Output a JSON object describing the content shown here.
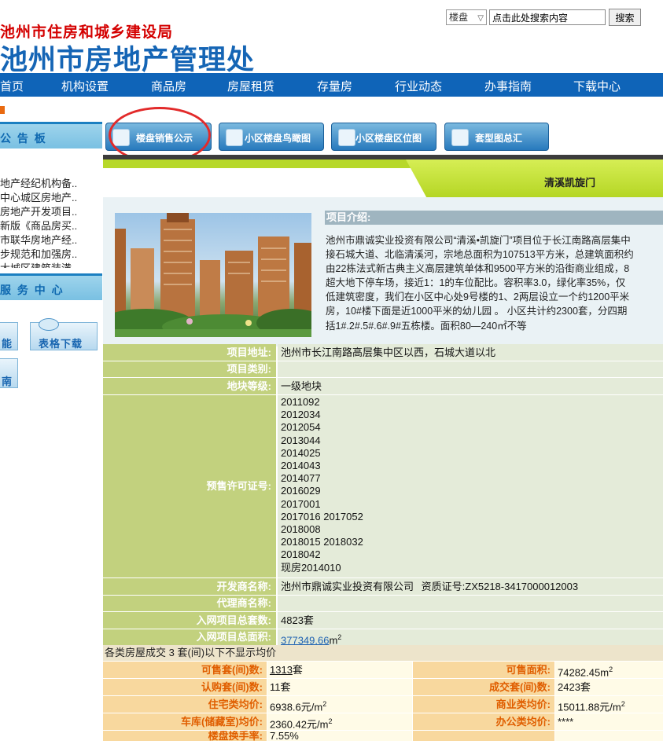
{
  "header": {
    "sub_title": "池州市住房和城乡建设局",
    "main_title": "池州市房地产管理处",
    "search": {
      "select_value": "楼盘",
      "input_value": "点击此处搜索内容",
      "button_label": "搜索"
    }
  },
  "nav": [
    "首页",
    "机构设置",
    "商品房",
    "房屋租赁",
    "存量房",
    "行业动态",
    "办事指南",
    "下载中心"
  ],
  "sidebar": {
    "notice_title": "公 告 板",
    "notices": [
      "地产经纪机构备..",
      "中心城区房地产..",
      "房地产开发项目..",
      "新版《商品房买..",
      "市联华房地产经..",
      "步规范和加强房..",
      "大城区建筑装潢.."
    ],
    "service_title": "服 务 中 心",
    "btn_func": "能",
    "btn_download": "表格下载",
    "btn_guide": "南"
  },
  "tabs": [
    "楼盘销售公示",
    "小区楼盘鸟瞰图",
    "小区楼盘区位图",
    "套型图总汇"
  ],
  "project": {
    "name": "清溪凯旋门",
    "intro_title": "项目介绍:",
    "intro_lines": [
      "池州市鼎诚实业投资有限公司“清溪•凯旋门”项目位于长江南路高层集中",
      "接石城大道、北临清溪河，宗地总面积为107513平方米，总建筑面积约",
      "由22栋法式新古典主义高层建筑单体和9500平方米的沿街商业组成，8",
      "超大地下停车场，接近1：1的车位配比。容积率3.0，绿化率35%，仅",
      "低建筑密度，我们在小区中心处9号楼的1、2两层设立一个约1200平米",
      "房，10#楼下面是近1000平米的幼儿园 。 小区共计约2300套，分四期",
      "括1#.2#.5#.6#.9#五栋楼。面积80—240㎡不等"
    ]
  },
  "info": {
    "address_label": "项目地址:",
    "address": "池州市长江南路高层集中区以西，石城大道以北",
    "category_label": "项目类别:",
    "category": "",
    "grade_label": "地块等级:",
    "grade": "一级地块",
    "permit_label": "预售许可证号:",
    "permits": [
      "2011092",
      "2012034",
      "2012054",
      "2013044",
      "2014025",
      "2014043",
      "2014077",
      "2016029",
      "2017001",
      "2017016 2017052",
      "2018008",
      "2018015 2018032",
      "2018042",
      "现房2014010"
    ],
    "developer_label": "开发商名称:",
    "developer": "池州市鼎诚实业投资有限公司",
    "qualification": "资质证号:ZX5218-3417000012003",
    "agent_label": "代理商名称:",
    "agent": "",
    "units_label": "入网项目总套数:",
    "units": "4823套",
    "area_label": "入网项目总面积:",
    "area_value": "377349.66",
    "area_unit": "m",
    "area_sup": "2"
  },
  "stats": {
    "header": "各类房屋成交 3 套(间)以下不显示均价",
    "rows": [
      {
        "l1": "可售套(间)数:",
        "v1_link": "1313",
        "v1": "套",
        "l2": "可售面积:",
        "v2": "74282.45m",
        "v2_sup": "2"
      },
      {
        "l1": "认购套(间)数:",
        "v1_link": "",
        "v1": "11套",
        "l2": "成交套(间)数:",
        "v2": "2423套",
        "v2_sup": ""
      },
      {
        "l1": "住宅类均价:",
        "v1_link": "",
        "v1": "6938.6元/m",
        "v1_sup": "2",
        "l2": "商业类均价:",
        "v2": "15011.88元/m",
        "v2_sup": "2"
      },
      {
        "l1": "车库(储藏室)均价:",
        "v1_link": "",
        "v1": "2360.42元/m",
        "v1_sup": "2",
        "l2": "办公类均价:",
        "v2": "****",
        "v2_sup": ""
      },
      {
        "l1": "楼盘换手率:",
        "v1_link": "",
        "v1": "7.55%",
        "l2": "",
        "v2": "",
        "v2_sup": ""
      }
    ]
  }
}
